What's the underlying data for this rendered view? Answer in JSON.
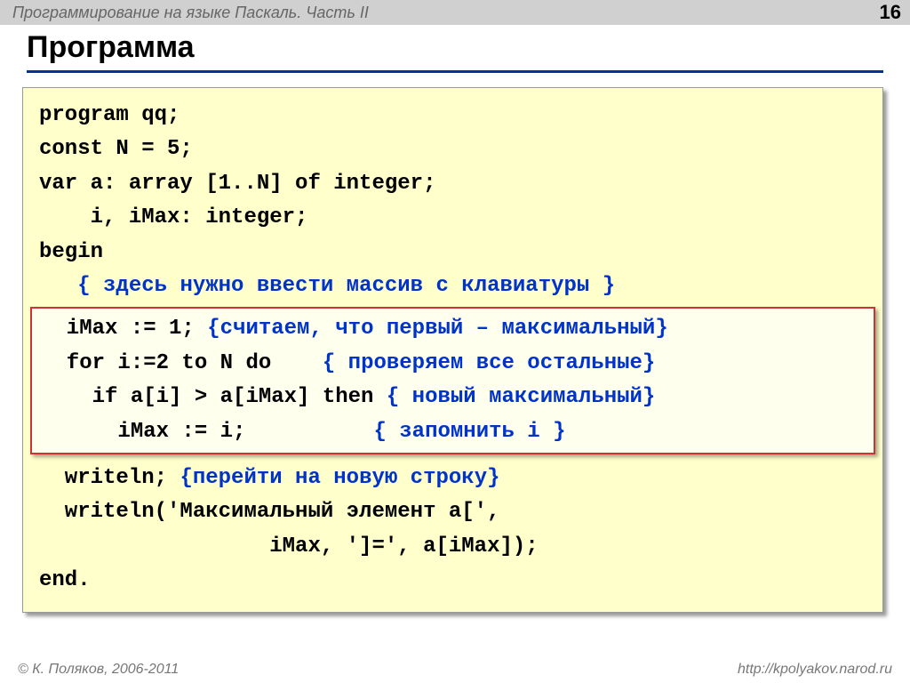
{
  "header": {
    "course": "Программирование на языке Паскаль. Часть II",
    "page": "16"
  },
  "title": "Программа",
  "code": {
    "l1": "program qq;",
    "l2": "const N = 5;",
    "l3": "var a: array [1..N] of integer;",
    "l4": "    i, iMax: integer;",
    "l5": "begin",
    "l6_indent": "   ",
    "l6_comment": "{ здесь нужно ввести массив с клавиатуры }",
    "hl1_code": "  iMax := 1; ",
    "hl1_comment": "{считаем, что первый – максимальный}",
    "hl2_code": "  for i:=2 to N do    ",
    "hl2_comment": "{ проверяем все остальные}",
    "hl3_code": "    if a[i] > a[iMax] then ",
    "hl3_comment": "{ новый максимальный}",
    "hl4_code": "      iMax := i;          ",
    "hl4_comment": "{ запомнить i }",
    "l7_code": "  writeln; ",
    "l7_comment": "{перейти на новую строку}",
    "l8": "  writeln('Максимальный элемент a[',",
    "l9": "                  iMax, ']=', a[iMax]);",
    "l10": "end."
  },
  "footer": {
    "copyright": "© К. Поляков, 2006-2011",
    "url": "http://kpolyakov.narod.ru"
  }
}
